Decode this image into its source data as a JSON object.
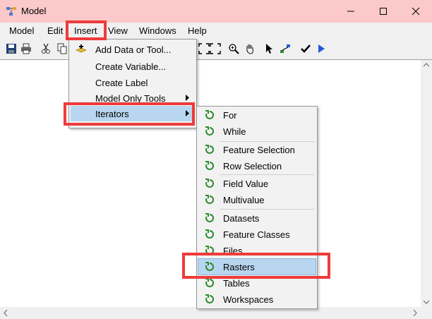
{
  "window": {
    "title": "Model",
    "icons": {
      "app": "model-icon",
      "minimize": "minimize-icon",
      "maximize": "maximize-icon",
      "close": "close-icon"
    }
  },
  "menubar": {
    "items": [
      "Model",
      "Edit",
      "Insert",
      "View",
      "Windows",
      "Help"
    ]
  },
  "toolbar": {
    "icons": [
      "save-icon",
      "print-icon",
      "cut-icon",
      "copy-icon",
      "add-data-icon",
      "full-extent-icon",
      "zoom-icon",
      "pan-icon",
      "select-icon",
      "connect-icon",
      "validate-icon",
      "run-icon"
    ]
  },
  "insert_menu": {
    "items": [
      {
        "label": "Add Data or Tool...",
        "icon": "add-data-icon",
        "submenu": false
      },
      {
        "label": "Create Variable...",
        "submenu": false
      },
      {
        "label": "Create Label",
        "submenu": false
      },
      {
        "label": "Model Only Tools",
        "submenu": true
      },
      {
        "label": "Iterators",
        "submenu": true,
        "selected": true
      }
    ]
  },
  "iterators_menu": {
    "item_icon": "iterator-icon",
    "items": [
      {
        "label": "For"
      },
      {
        "label": "While"
      },
      {
        "label": "Feature Selection"
      },
      {
        "label": "Row Selection"
      },
      {
        "label": "Field Value"
      },
      {
        "label": "Multivalue"
      },
      {
        "label": "Datasets"
      },
      {
        "label": "Feature Classes"
      },
      {
        "label": "Files"
      },
      {
        "label": "Rasters",
        "selected": true
      },
      {
        "label": "Tables"
      },
      {
        "label": "Workspaces"
      }
    ]
  },
  "colors": {
    "titlebar": "#fbc9c9",
    "highlight": "#ee3b3b",
    "selection": "#b8d6f0",
    "iterator_icon": "#2e8b2e"
  }
}
